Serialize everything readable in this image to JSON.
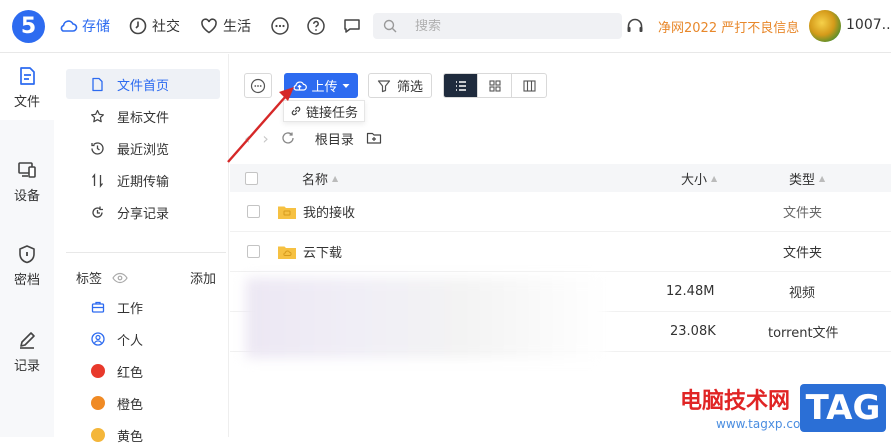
{
  "header": {
    "logo_text": "5",
    "nav": [
      {
        "label": "存储",
        "icon": "cloud-icon"
      },
      {
        "label": "社交",
        "icon": "clock-icon"
      },
      {
        "label": "生活",
        "icon": "heart-icon"
      }
    ],
    "more_icon": "more-icon",
    "help_icon": "help-icon",
    "chat_icon": "chat-icon",
    "search_placeholder": "搜索",
    "promo": "净网2022 严打不良信息",
    "username": "1007.."
  },
  "rail": {
    "items": [
      {
        "label": "文件",
        "icon": "file-icon",
        "active": true
      },
      {
        "label": "设备",
        "icon": "device-icon",
        "active": false
      },
      {
        "label": "密档",
        "icon": "shield-icon",
        "active": false
      },
      {
        "label": "记录",
        "icon": "pen-icon",
        "active": false
      }
    ]
  },
  "sidebar": {
    "items": [
      {
        "label": "文件首页",
        "icon": "doc-icon",
        "active": true
      },
      {
        "label": "星标文件",
        "icon": "star-icon",
        "active": false
      },
      {
        "label": "最近浏览",
        "icon": "history-icon",
        "active": false
      },
      {
        "label": "近期传输",
        "icon": "transfer-icon",
        "active": false
      },
      {
        "label": "分享记录",
        "icon": "share-icon",
        "active": false
      }
    ],
    "tags_label": "标签",
    "tags_add": "添加",
    "tags": [
      {
        "label": "工作",
        "icon": "briefcase-icon"
      },
      {
        "label": "个人",
        "icon": "person-icon"
      },
      {
        "label": "红色",
        "color": "#e8392b"
      },
      {
        "label": "橙色",
        "color": "#f08a24"
      },
      {
        "label": "黄色",
        "color": "#f4b63a"
      }
    ]
  },
  "toolbar": {
    "upload_label": "上传",
    "filter_label": "筛选",
    "dropdown_item": "链接任务"
  },
  "breadcrumb": {
    "root": "根目录"
  },
  "table": {
    "columns": {
      "name": "名称",
      "size": "大小",
      "type": "类型"
    },
    "rows": [
      {
        "name": "我的接收",
        "size": "",
        "type": "文件夹"
      },
      {
        "name": "云下载",
        "size": "",
        "type": "文件夹"
      },
      {
        "name": "",
        "size": "12.48M",
        "type": "视频"
      },
      {
        "name": "",
        "size": "23.08K",
        "type": "torrent文件"
      }
    ]
  },
  "watermark": {
    "title": "电脑技术网",
    "url": "www.tagxp.com",
    "tag": "TAG"
  },
  "colors": {
    "accent": "#2d6bf0",
    "promo": "#e8882b",
    "arrow": "#d62828"
  }
}
